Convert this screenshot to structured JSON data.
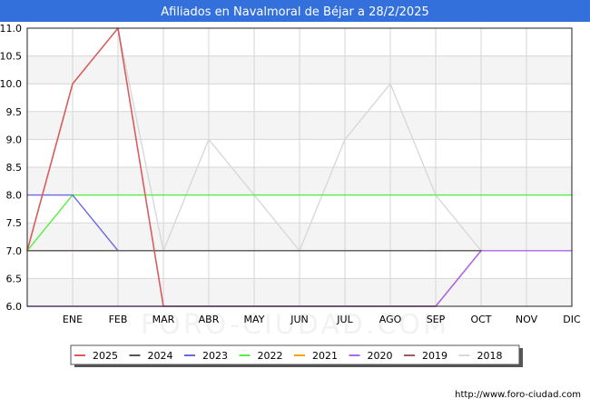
{
  "chart_data": {
    "type": "line",
    "title": "Afiliados en Navalmoral de Béjar a 28/2/2025",
    "colors": {
      "title_bar": "#3370db",
      "plot_bg_band": "#f4f4f4",
      "grid": "#d6d6d6"
    },
    "categories": [
      "",
      "ENE",
      "FEB",
      "MAR",
      "ABR",
      "MAY",
      "JUN",
      "JUL",
      "AGO",
      "SEP",
      "OCT",
      "NOV",
      "DIC"
    ],
    "ylim": [
      6.0,
      11.0
    ],
    "y_ticks": [
      "6.0",
      "6.5",
      "7.0",
      "7.5",
      "8.0",
      "8.5",
      "9.0",
      "9.5",
      "10.0",
      "10.5",
      "11.0"
    ],
    "grid": true,
    "legend_position": "bottom",
    "series": [
      {
        "name": "2025",
        "color": "#e05a5a",
        "values": [
          7,
          10,
          11,
          6
        ]
      },
      {
        "name": "2024",
        "color": "#555555",
        "values": [
          7,
          7,
          7,
          7,
          7,
          7,
          7,
          7,
          7,
          7,
          7
        ]
      },
      {
        "name": "2023",
        "color": "#6a6ae0",
        "values": [
          8,
          8,
          7
        ]
      },
      {
        "name": "2022",
        "color": "#55ee44",
        "values": [
          7,
          8,
          8,
          8,
          8,
          8,
          8,
          8,
          8,
          8,
          8,
          8,
          8
        ]
      },
      {
        "name": "2021",
        "color": "#f0a800",
        "values": [
          7,
          7,
          7
        ]
      },
      {
        "name": "2020",
        "color": "#b266e8",
        "values": [
          6,
          6,
          6,
          6,
          6,
          6,
          6,
          6,
          6,
          6,
          7,
          7,
          7
        ]
      },
      {
        "name": "2019",
        "color": "#a05a5a",
        "values": [
          7,
          10,
          11,
          6,
          6,
          6,
          6,
          6,
          6,
          6,
          7
        ]
      },
      {
        "name": "2018",
        "color": "#d8d8d8",
        "values": [
          7,
          10,
          11,
          7,
          9,
          8,
          7,
          9,
          10,
          8,
          7
        ]
      }
    ],
    "source": "http://www.foro-ciudad.com",
    "watermark": "FORO-CIUDAD.COM"
  }
}
